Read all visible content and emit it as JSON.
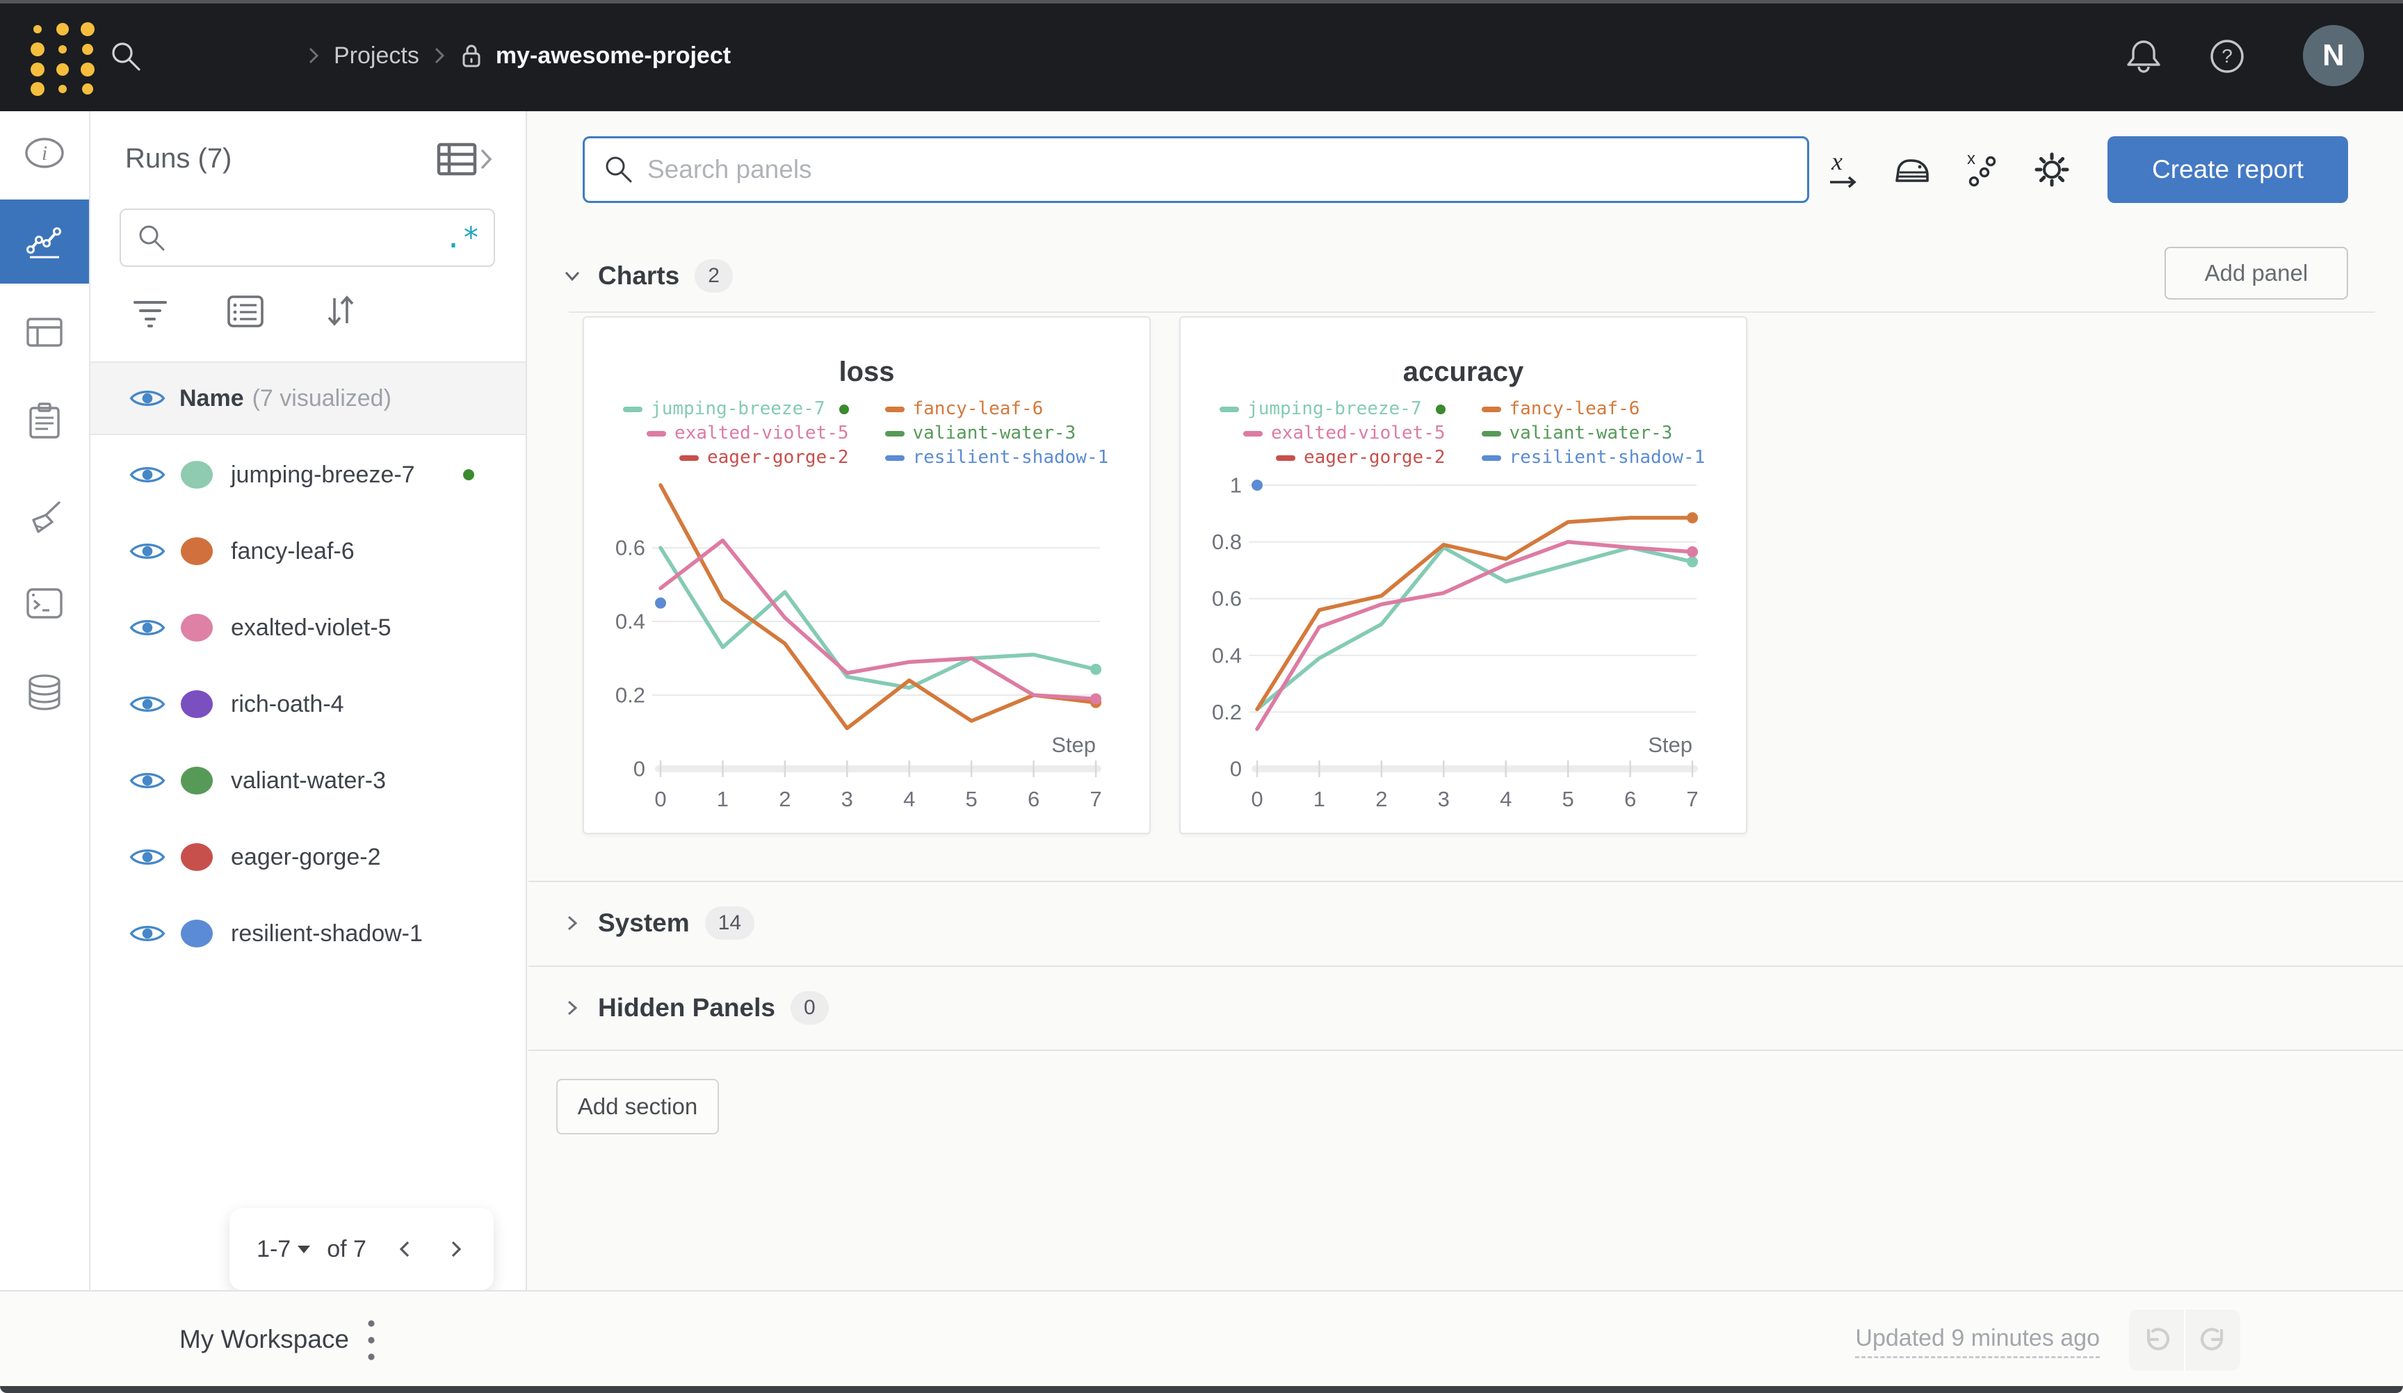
{
  "colors": {
    "accent_blue": "#4479c4",
    "topbar_bg": "#1b1d21",
    "logo_yellow": "#f5be3d",
    "running_green": "#3a8a2e",
    "regex_teal": "#21a6be",
    "eye_blue": "#4587c7"
  },
  "topbar": {
    "breadcrumb": {
      "level1": "Projects",
      "level2": "my-awesome-project"
    },
    "avatar_initial": "N"
  },
  "runs_panel": {
    "title": "Runs (7)",
    "search_value": "",
    "regex_toggle": ".*",
    "header_name": "Name",
    "header_visualized": "(7 visualized)",
    "runs": [
      {
        "name": "jumping-breeze-7",
        "color": "#8ecbb0",
        "running": true
      },
      {
        "name": "fancy-leaf-6",
        "color": "#d1703c"
      },
      {
        "name": "exalted-violet-5",
        "color": "#de81a4"
      },
      {
        "name": "rich-oath-4",
        "color": "#7a4fc0"
      },
      {
        "name": "valiant-water-3",
        "color": "#579a58"
      },
      {
        "name": "eager-gorge-2",
        "color": "#c8504c"
      },
      {
        "name": "resilient-shadow-1",
        "color": "#5b8bd4"
      }
    ],
    "pagination": {
      "range": "1-7",
      "of": "of 7"
    }
  },
  "toolbar": {
    "search_placeholder": "Search panels",
    "create_report_label": "Create report"
  },
  "sections": {
    "charts": {
      "label": "Charts",
      "count": "2"
    },
    "system": {
      "label": "System",
      "count": "14"
    },
    "hidden_panels": {
      "label": "Hidden Panels",
      "count": "0"
    },
    "add_panel_label": "Add panel",
    "add_section_label": "Add section"
  },
  "footer": {
    "workspace_label": "My Workspace",
    "updated_text": "Updated 9 minutes ago"
  },
  "chart_data": [
    {
      "type": "line",
      "title": "loss",
      "xlabel": "Step",
      "x": [
        0,
        1,
        2,
        3,
        4,
        5,
        6,
        7
      ],
      "xticks": [
        0,
        1,
        2,
        3,
        4,
        5,
        6,
        7
      ],
      "yticks": [
        0,
        0.2,
        0.4,
        0.6
      ],
      "ylim": [
        0,
        0.8
      ],
      "grid": true,
      "legend_position": "top",
      "series": [
        {
          "name": "jumping-breeze-7",
          "color": "#84cbb4",
          "running": true,
          "end_dot": true,
          "values": [
            0.6,
            0.33,
            0.48,
            0.25,
            0.22,
            0.3,
            0.31,
            0.27
          ]
        },
        {
          "name": "fancy-leaf-6",
          "color": "#d4793c",
          "end_dot": true,
          "values": [
            0.77,
            0.46,
            0.34,
            0.11,
            0.24,
            0.13,
            0.2,
            0.18
          ]
        },
        {
          "name": "exalted-violet-5",
          "color": "#dd7ba3",
          "end_dot": true,
          "values": [
            0.49,
            0.62,
            0.41,
            0.26,
            0.29,
            0.3,
            0.2,
            0.19
          ]
        },
        {
          "name": "valiant-water-3",
          "color": "#579a58",
          "values": []
        },
        {
          "name": "eager-gorge-2",
          "color": "#c8504c",
          "values": []
        },
        {
          "name": "resilient-shadow-1",
          "color": "#5b8bd4",
          "point_only": true,
          "values": [
            0.45
          ]
        }
      ]
    },
    {
      "type": "line",
      "title": "accuracy",
      "xlabel": "Step",
      "x": [
        0,
        1,
        2,
        3,
        4,
        5,
        6,
        7
      ],
      "xticks": [
        0,
        1,
        2,
        3,
        4,
        5,
        6,
        7
      ],
      "yticks": [
        0,
        0.2,
        0.4,
        0.6,
        0.8,
        1
      ],
      "ylim": [
        0,
        1.02
      ],
      "grid": true,
      "legend_position": "top",
      "series": [
        {
          "name": "jumping-breeze-7",
          "color": "#84cbb4",
          "running": true,
          "end_dot": true,
          "values": [
            0.21,
            0.39,
            0.51,
            0.78,
            0.66,
            0.72,
            0.78,
            0.73
          ]
        },
        {
          "name": "fancy-leaf-6",
          "color": "#d4793c",
          "end_dot": true,
          "values": [
            0.21,
            0.56,
            0.61,
            0.79,
            0.74,
            0.87,
            0.885,
            0.885
          ]
        },
        {
          "name": "exalted-violet-5",
          "color": "#dd7ba3",
          "end_dot": true,
          "values": [
            0.14,
            0.5,
            0.58,
            0.62,
            0.72,
            0.8,
            0.78,
            0.765
          ]
        },
        {
          "name": "valiant-water-3",
          "color": "#579a58",
          "values": []
        },
        {
          "name": "eager-gorge-2",
          "color": "#c8504c",
          "values": []
        },
        {
          "name": "resilient-shadow-1",
          "color": "#5b8bd4",
          "point_only": true,
          "values": [
            1.0
          ]
        }
      ]
    }
  ]
}
